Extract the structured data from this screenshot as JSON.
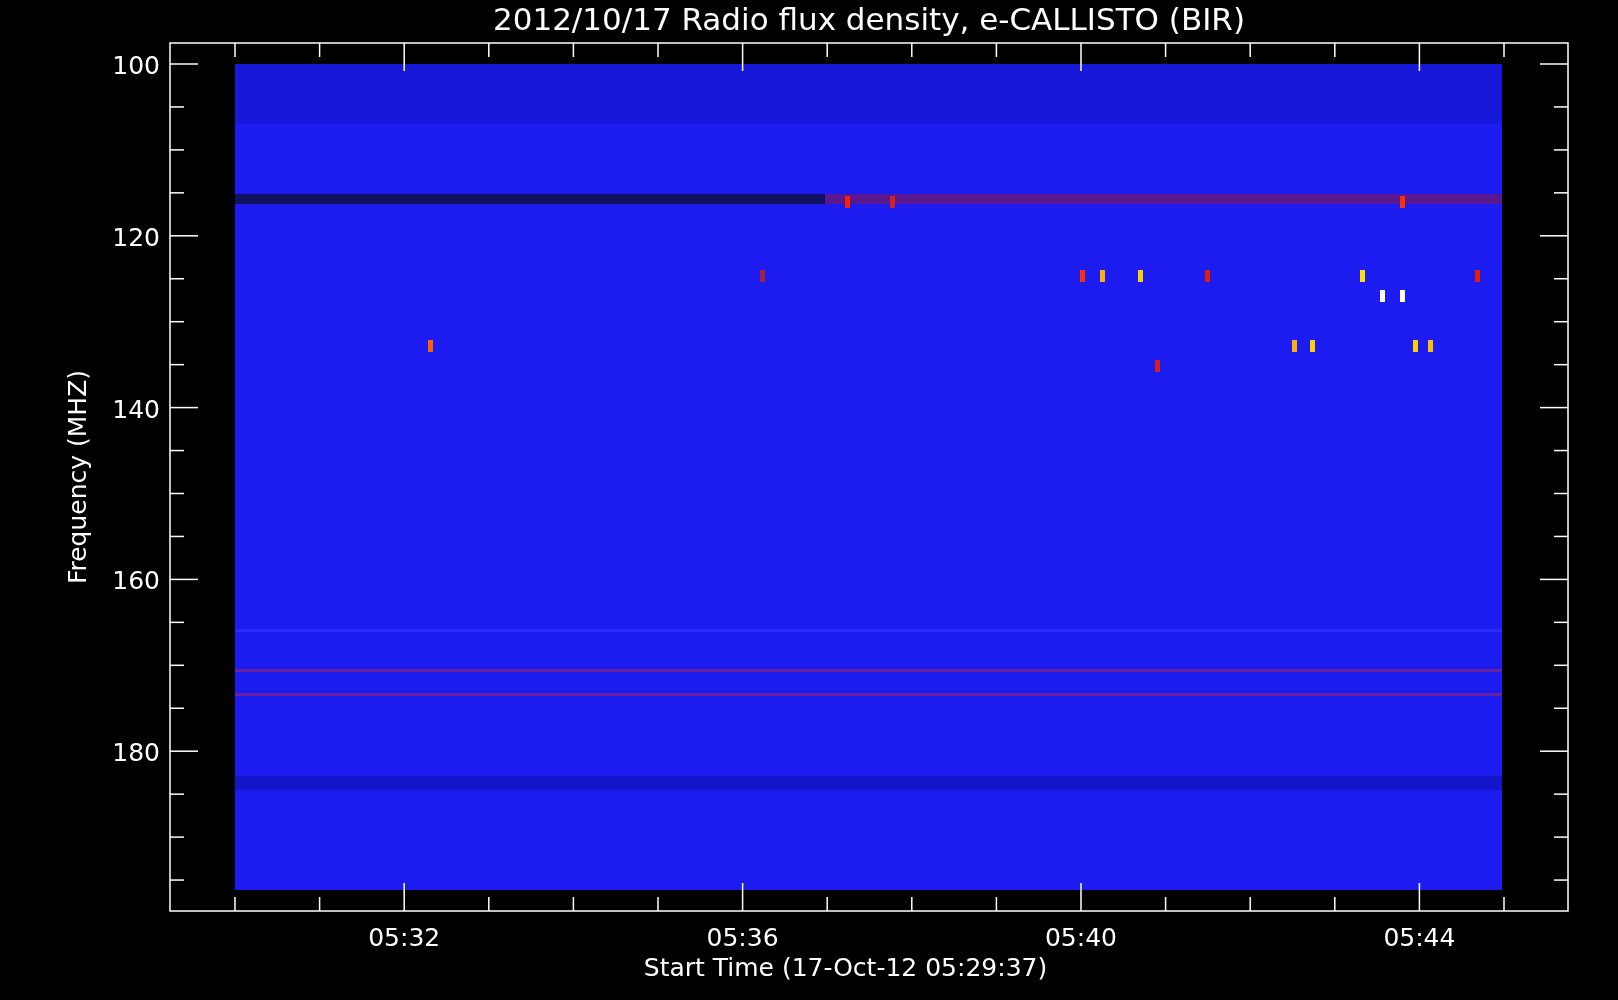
{
  "title": "2012/10/17  Radio flux density, e-CALLISTO (BIR)",
  "y_axis": {
    "label": "Frequency (MHZ)",
    "ticks": [
      "100",
      "120",
      "140",
      "160",
      "180"
    ]
  },
  "x_axis": {
    "label": "Start Time (17-Oct-12 05:29:37)",
    "ticks": [
      "05:32",
      "05:36",
      "05:40",
      "05:44"
    ]
  }
}
